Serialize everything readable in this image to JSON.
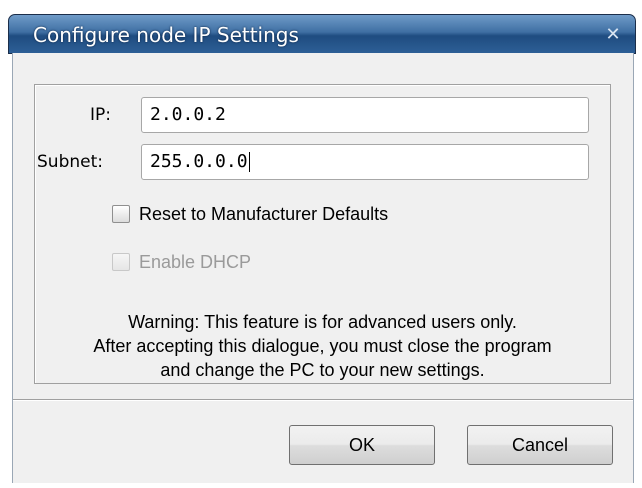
{
  "window": {
    "title": "Configure node IP Settings",
    "close_symbol": "✕"
  },
  "form": {
    "ip_label": "IP:",
    "ip_value": "2.0.0.2",
    "subnet_label": "Subnet:",
    "subnet_value": "255.0.0.0"
  },
  "options": {
    "reset_label": "Reset to Manufacturer Defaults",
    "reset_checked": false,
    "dhcp_label": "Enable DHCP",
    "dhcp_checked": false,
    "dhcp_enabled": false
  },
  "warning": {
    "line1": "Warning: This feature is for advanced users only.",
    "line2": "After accepting this dialogue, you must close the program",
    "line3": "and change the PC to your new settings."
  },
  "buttons": {
    "ok_label": "OK",
    "cancel_label": "Cancel"
  },
  "colors": {
    "titlebar": "#2d5f96",
    "dialog_bg": "#f0f0f0",
    "disabled_text": "#9a9a9a"
  }
}
